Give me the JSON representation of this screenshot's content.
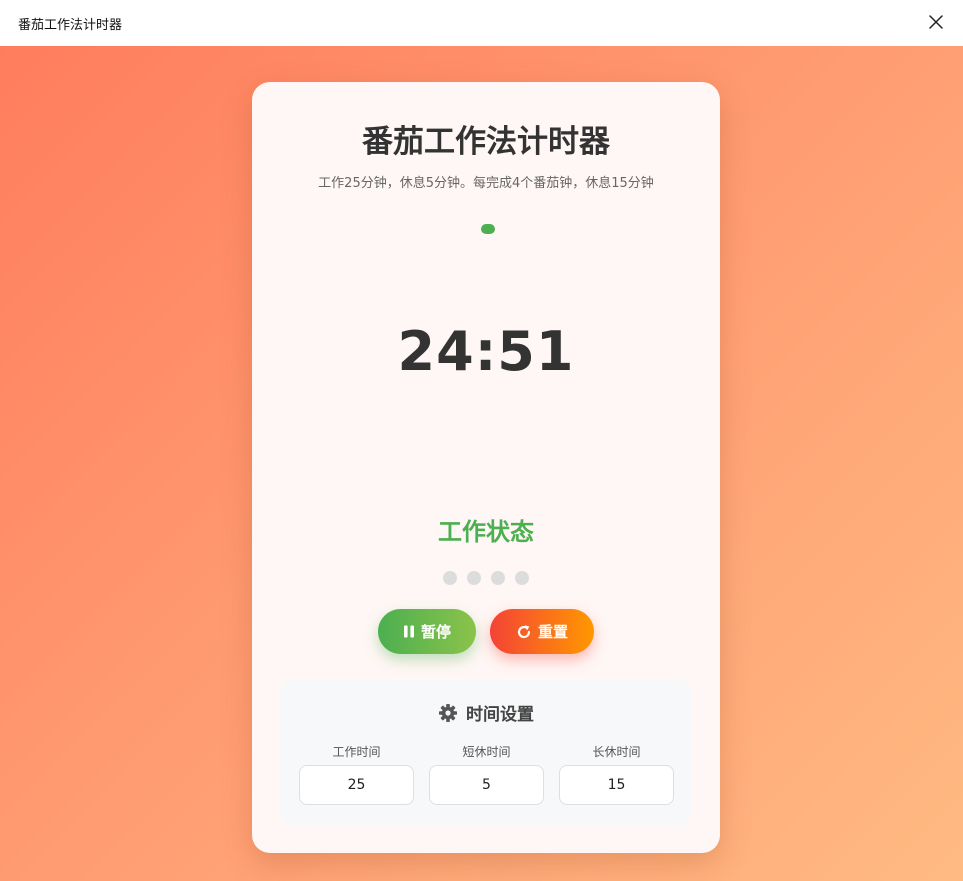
{
  "window": {
    "title": "番茄工作法计时器"
  },
  "card": {
    "title": "番茄工作法计时器",
    "subtitle": "工作25分钟，休息5分钟。每完成4个番茄钟，休息15分钟",
    "timer": "24:51",
    "status": "工作状态",
    "completed_pomodoros": 0,
    "total_pomodoros": 4
  },
  "buttons": {
    "pause_label": "暂停",
    "reset_label": "重置"
  },
  "icons": {
    "close": "close-icon",
    "pause": "pause-icon",
    "reset": "reset-icon",
    "settings": "gear-icon"
  },
  "settings": {
    "title": "时间设置",
    "work_label": "工作时间",
    "work_value": "25",
    "short_break_label": "短休时间",
    "short_break_value": "5",
    "long_break_label": "长休时间",
    "long_break_value": "15"
  },
  "colors": {
    "accent_green": "#4caf50",
    "reset_red": "#f44336",
    "reset_orange": "#ff9800",
    "background_start": "#ff7d5c",
    "background_end": "#ffba82"
  }
}
